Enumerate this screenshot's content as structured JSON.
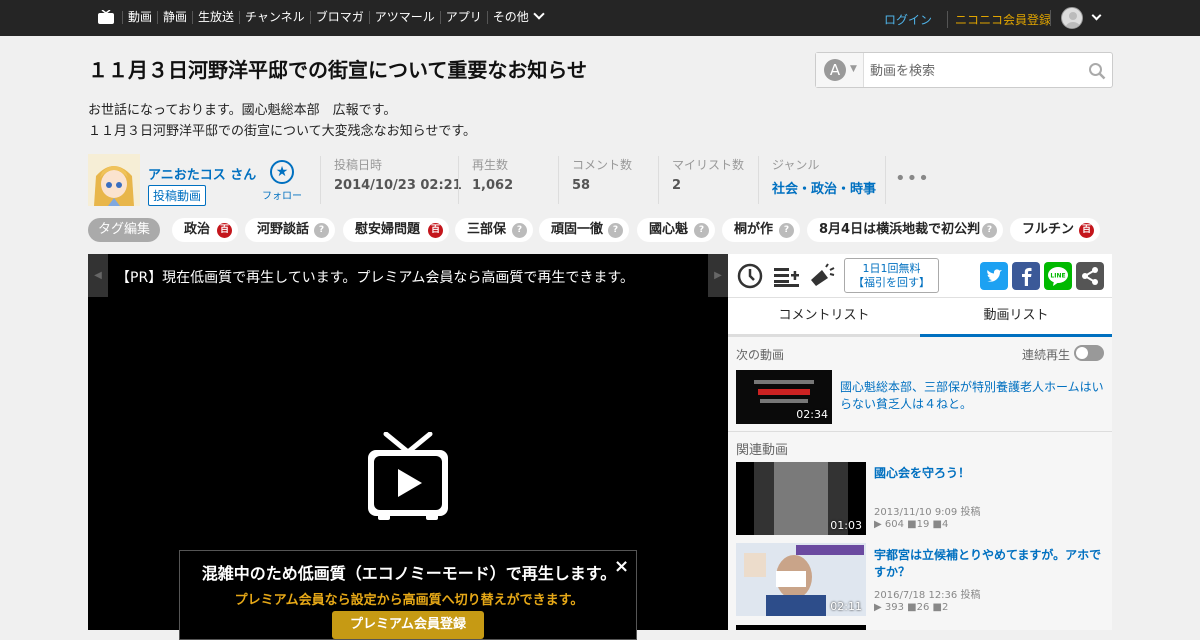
{
  "topbar": {
    "nav": [
      "動画",
      "静画",
      "生放送",
      "チャンネル",
      "ブロマガ",
      "アツマール",
      "アプリ",
      "その他"
    ],
    "login": "ログイン",
    "register": "ニコニコ会員登録"
  },
  "video": {
    "title": "１１月３日河野洋平邸での街宣について重要なお知らせ",
    "description": [
      "お世話になっております。國心魁総本部　広報です。",
      "１１月３日河野洋平邸での街宣について大変残念なお知らせです。"
    ]
  },
  "search": {
    "placeholder": "動画を検索",
    "type_icon": "A"
  },
  "uploader": {
    "name": "アニおたコス さん",
    "badge": "投稿動画",
    "follow": "フォロー"
  },
  "stats": [
    {
      "label": "投稿日時",
      "value": "2014/10/23 02:21"
    },
    {
      "label": "再生数",
      "value": "1,062"
    },
    {
      "label": "コメント数",
      "value": "58"
    },
    {
      "label": "マイリスト数",
      "value": "2"
    },
    {
      "label": "ジャンル",
      "value": "社会・政治・時事"
    }
  ],
  "tags": {
    "edit_label": "タグ編集",
    "items": [
      {
        "name": "政治",
        "dic": true
      },
      {
        "name": "河野談話",
        "dic": false
      },
      {
        "name": "慰安婦問題",
        "dic": true
      },
      {
        "name": "三部保",
        "dic": false
      },
      {
        "name": "頑固一徹",
        "dic": false
      },
      {
        "name": "國心魁",
        "dic": false
      },
      {
        "name": "桐が作",
        "dic": false
      },
      {
        "name": "8月4日は横浜地裁で初公判",
        "dic": false
      },
      {
        "name": "フルチン",
        "dic": true
      }
    ],
    "dic_icon": "百",
    "nodic_icon": "?"
  },
  "player": {
    "pr_text": "【PR】現在低画質で再生しています。プレミアム会員なら高画質で再生できます。",
    "eco_title": "混雑中のため低画質（エコノミーモード）で再生します。",
    "eco_sub": "プレミアム会員なら設定から高画質へ切り替えができます。",
    "eco_button": "プレミアム会員登録",
    "close": "×"
  },
  "side": {
    "free_box": [
      "1日1回無料",
      "【福引を回す】"
    ],
    "social": {
      "twitter": "t",
      "facebook": "f",
      "line": "LINE",
      "share": "share"
    },
    "tabs": [
      "コメントリスト",
      "動画リスト"
    ],
    "next_header": "次の動画",
    "autoplay_label": "連続再生",
    "autoplay_on": false,
    "next_video": {
      "title": "國心魁総本部、三部保が特別養護老人ホームはいらない貧乏人は４ねと。",
      "duration": "02:34"
    },
    "related_header": "関連動画",
    "related": [
      {
        "title": "國心会を守ろう！",
        "duration": "01:03",
        "posted": "2013/11/10 9:09 投稿",
        "views": "604",
        "comments": "19",
        "mylists": "4"
      },
      {
        "title": "宇都宮は立候補とりやめてますが。アホですか？",
        "duration": "02:11",
        "posted": "2016/7/18 12:36 投稿",
        "views": "393",
        "comments": "26",
        "mylists": "2"
      }
    ]
  },
  "colors": {
    "accent": "#0070c0",
    "header_bg": "#252525",
    "premium": "#e6a817"
  }
}
